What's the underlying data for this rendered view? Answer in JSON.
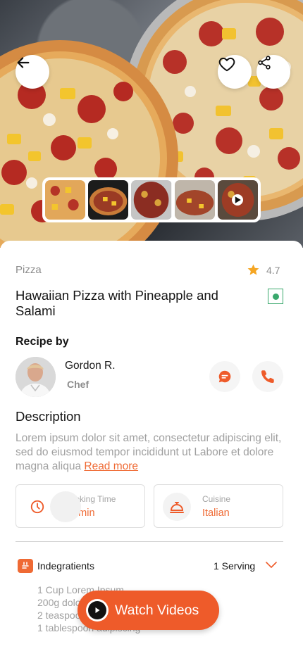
{
  "recipe": {
    "category": "Pizza",
    "rating": "4.7",
    "title": "Hawaiian Pizza with Pineapple and Salami",
    "recipe_by_label": "Recipe by",
    "chef": {
      "name": "Gordon R.",
      "role": "Chef"
    },
    "description_title": "Description",
    "description": "Lorem ipsum dolor sit amet, consectetur adipiscing elit, sed do eiusmod tempor incididunt ut Labore et dolore magna aliqua ",
    "read_more": "Read more",
    "cooking": {
      "label": "Cooking Time",
      "value": "15 min"
    },
    "cuisine": {
      "label": "Cuisine",
      "value": "Italian"
    },
    "ingredients_title": "Indegratients",
    "serving": "1 Serving",
    "ingredients": [
      "1 Cup Lorem Ipsum",
      "200g dolor sit",
      "2 teaspoon amet",
      "1 tablespoon adipiscing"
    ],
    "watch_label": "Watch Videos"
  },
  "colors": {
    "accent": "#EE5B2A",
    "star": "#F5A623",
    "veg": "#3AA86D",
    "muted": "#8D8D8D"
  },
  "icons": [
    "back-arrow-icon",
    "heart-icon",
    "share-icon",
    "star-icon",
    "veg-icon",
    "chat-icon",
    "phone-icon",
    "clock-icon",
    "cloche-icon",
    "ingredients-icon",
    "chevron-down-icon",
    "play-icon"
  ]
}
